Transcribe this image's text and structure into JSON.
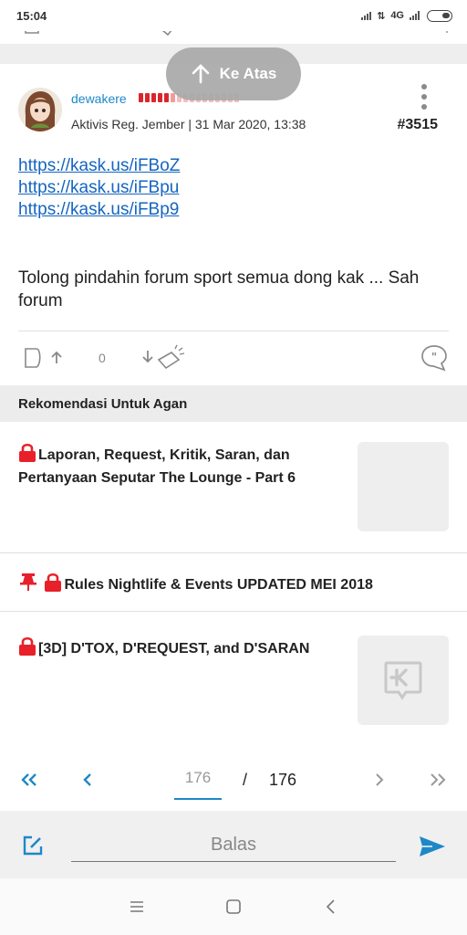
{
  "status_bar": {
    "time": "15:04",
    "network": "4G"
  },
  "scroll_top_button": {
    "label": "Ke Atas"
  },
  "post": {
    "username": "dewakere",
    "meta": "Aktivis Reg. Jember | 31 Mar 2020, 13:38",
    "number": "#3515",
    "links": [
      "https://kask.us/iFBoZ",
      "https://kask.us/iFBpu",
      "https://kask.us/iFBp9"
    ],
    "text": "Tolong pindahin forum sport semua dong kak ... Sah forum",
    "vote_count": "0"
  },
  "recommendations": {
    "header": "Rekomendasi Untuk Agan",
    "items": [
      {
        "title": "Laporan, Request, Kritik, Saran, dan Pertanyaan Seputar The Lounge - Part 6"
      },
      {
        "title": "Rules Nightlife & Events UPDATED MEI 2018"
      },
      {
        "title": "[3D] D'TOX, D'REQUEST, and D'SARAN"
      }
    ]
  },
  "pagination": {
    "current": "176",
    "separator": "/",
    "total": "176"
  },
  "reply": {
    "placeholder": "Balas"
  },
  "colors": {
    "accent": "#1e88c7",
    "lock": "#e8202a",
    "link": "#1565c0"
  }
}
